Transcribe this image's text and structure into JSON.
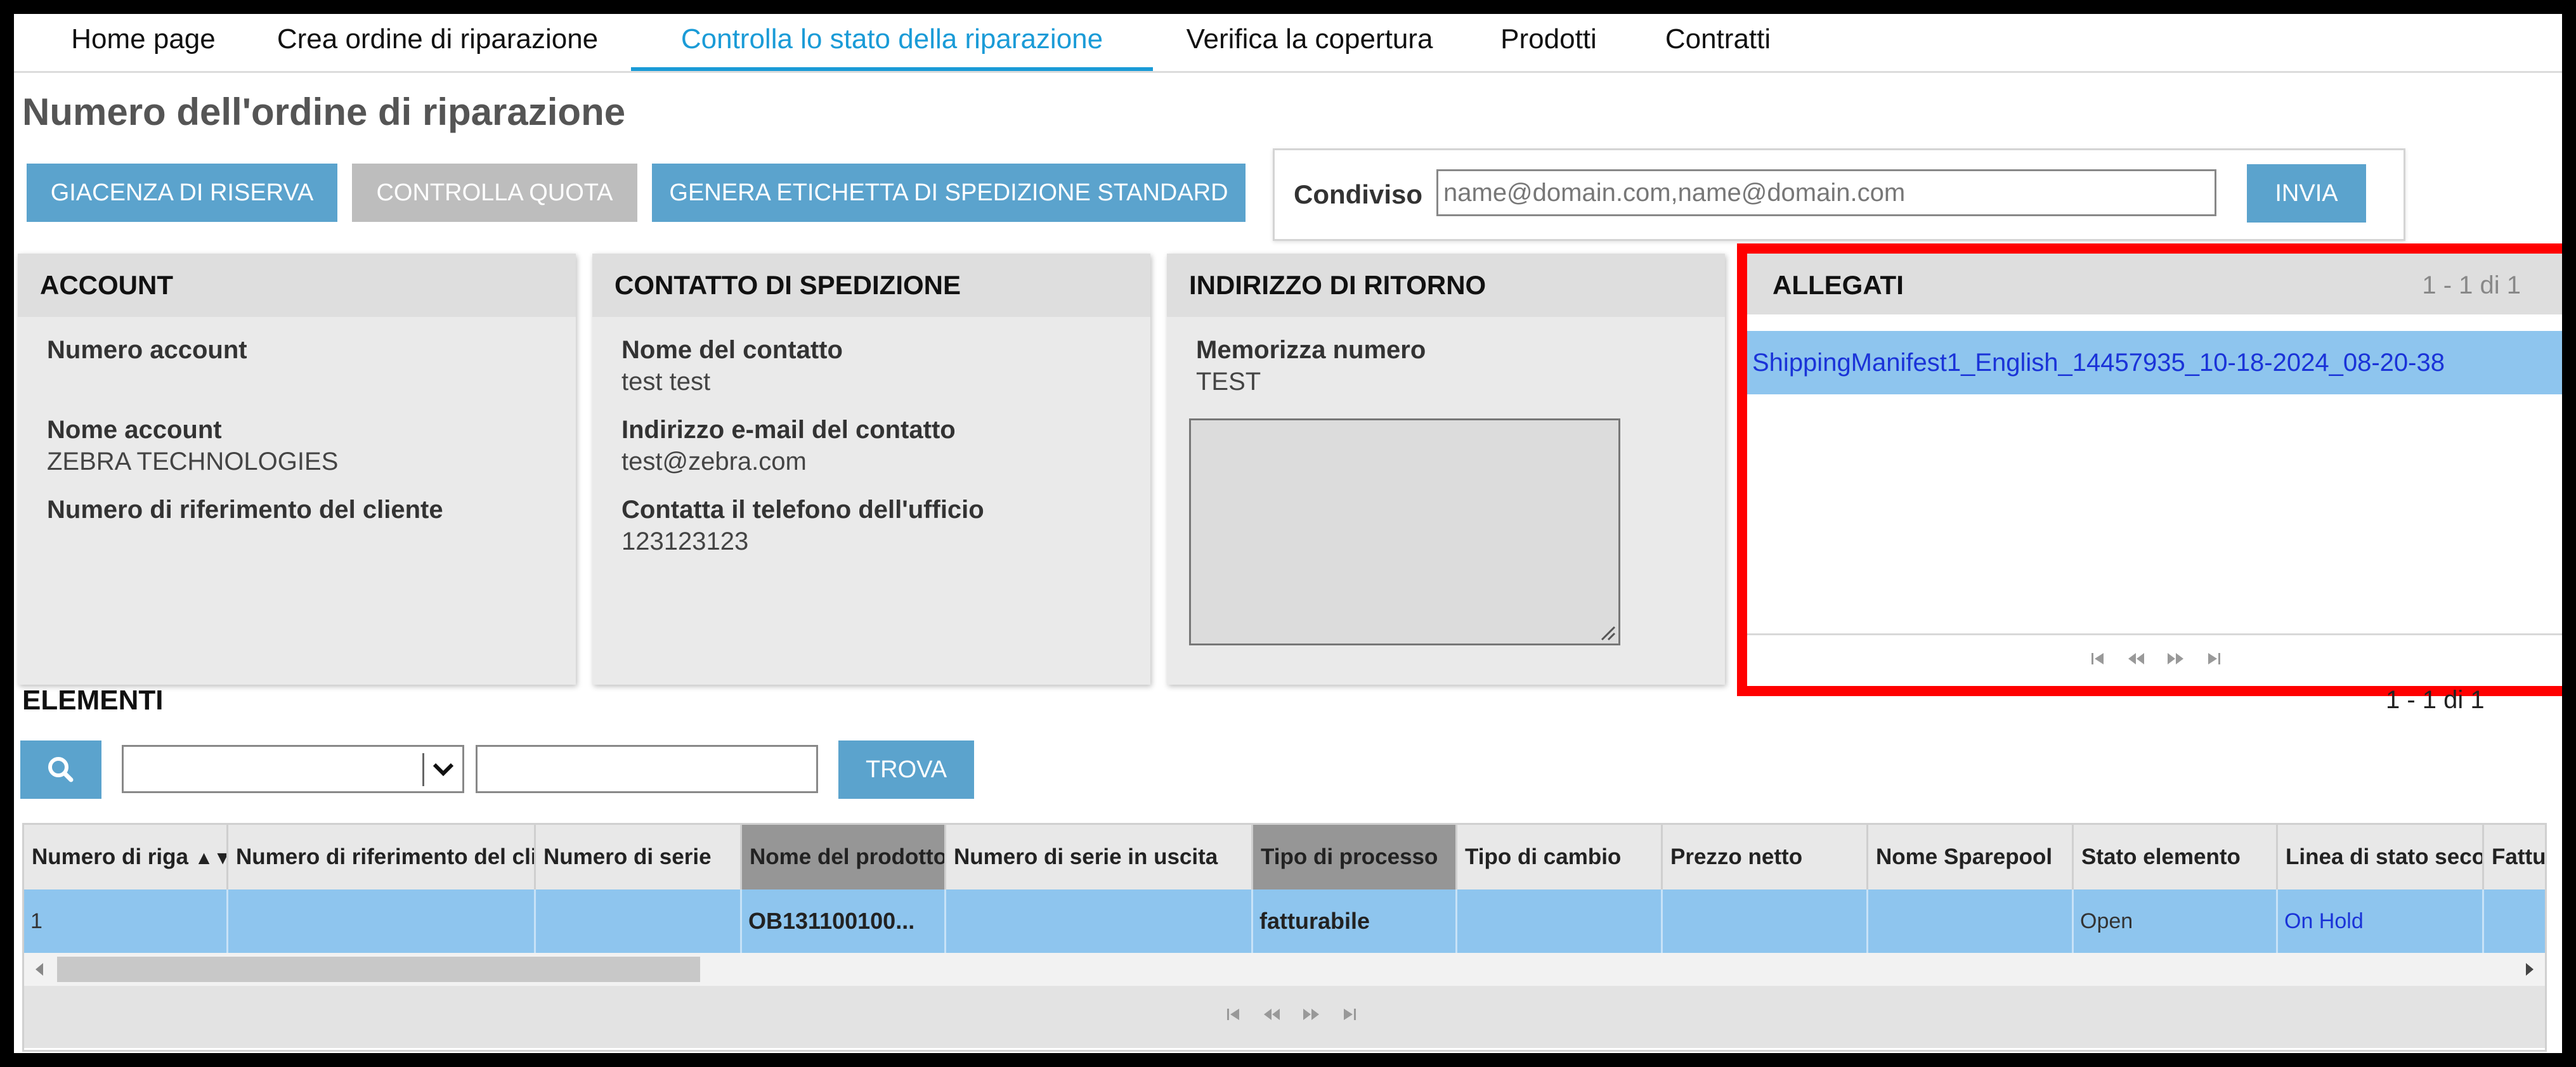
{
  "nav": {
    "tabs": [
      {
        "label": "Home page",
        "active": false
      },
      {
        "label": "Crea ordine di riparazione",
        "active": false
      },
      {
        "label": "Controlla lo stato della riparazione",
        "active": true
      },
      {
        "label": "Verifica la copertura",
        "active": false
      },
      {
        "label": "Prodotti",
        "active": false
      },
      {
        "label": "Contratti",
        "active": false
      }
    ]
  },
  "page": {
    "title": "Numero dell'ordine di riparazione"
  },
  "toolbar": {
    "stock_label": "GIACENZA DI RISERVA",
    "quota_label": "CONTROLLA QUOTA",
    "label_label": "GENERA ETICHETTA DI SPEDIZIONE STANDARD"
  },
  "share": {
    "label": "Condiviso",
    "placeholder": "name@domain.com,name@domain.com",
    "send_label": "INVIA"
  },
  "account": {
    "title": "ACCOUNT",
    "number_label": "Numero account",
    "name_label": "Nome account",
    "name_value": "ZEBRA TECHNOLOGIES",
    "ref_label": "Numero di riferimento del cliente"
  },
  "shipping_contact": {
    "title": "CONTATTO DI SPEDIZIONE",
    "name_label": "Nome del contatto",
    "name_value": "test test",
    "email_label": "Indirizzo e-mail del contatto",
    "email_value": "test@zebra.com",
    "phone_label": "Contatta il telefono dell'ufficio",
    "phone_value": "123123123"
  },
  "return_address": {
    "title": "INDIRIZZO DI RITORNO",
    "store_label": "Memorizza numero",
    "store_value": "TEST"
  },
  "attachments": {
    "title": "ALLEGATI",
    "count": "1 - 1 di 1",
    "files": [
      "ShippingManifest1_English_14457935_10-18-2024_08-20-38"
    ]
  },
  "elements": {
    "title": "ELEMENTI",
    "count": "1 - 1 di 1",
    "find_label": "TROVA",
    "columns": [
      "Numero di riga",
      "Numero di riferimento del cliente",
      "Numero di serie",
      "Nome del prodotto",
      "Numero di serie in uscita",
      "Tipo di processo",
      "Tipo di cambio",
      "Prezzo netto",
      "Nome Sparepool",
      "Stato elemento",
      "Linea di stato secondario",
      "Fatturabile"
    ],
    "rows": [
      [
        "1",
        "",
        "",
        "OB131100100...",
        "",
        "fatturabile",
        "",
        "",
        "",
        "Open",
        "On Hold",
        ""
      ]
    ]
  }
}
